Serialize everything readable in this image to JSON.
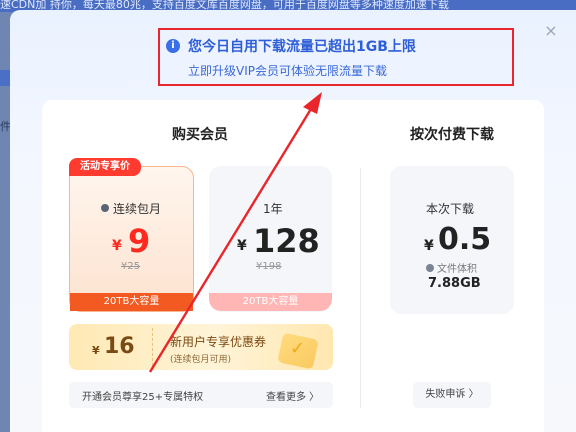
{
  "background": {
    "top_text": "速CDN加 持你，每天最80兆，支持百度文库百度网盘，可用于百度网盘等多种速度加速下载",
    "left_char": "件"
  },
  "dialog": {
    "close_glyph": "×",
    "notice": {
      "icon": "i",
      "title": "您今日自用下载流量已超出1GB上限",
      "subtitle": "立即升级VIP会员可体验无限流量下载"
    },
    "vip_section_title": "购买会员",
    "pay_section_title": "按次付费下载",
    "plans": [
      {
        "badge": "活动专享价",
        "name": "连续包月",
        "currency": "¥",
        "price": "9",
        "original_price": "¥25",
        "capacity": "20TB大容量"
      },
      {
        "name": "1年",
        "currency": "¥",
        "price": "128",
        "original_price": "¥198",
        "capacity": "20TB大容量"
      }
    ],
    "coupon": {
      "currency": "¥",
      "amount": "16",
      "title": "新用户专享优惠券",
      "note": "(连续包月可用)"
    },
    "benefits": {
      "text": "开通会员尊享25+专属特权",
      "more": "查看更多 〉"
    },
    "pay_per_download": {
      "label": "本次下载",
      "currency": "¥",
      "price": "0.5",
      "size_label": "文件体积",
      "size_value": "7.88GB",
      "fail_button": "失败申诉 〉"
    }
  },
  "colors": {
    "notice_border": "#e8262b",
    "accent_blue": "#2f5fd8",
    "price_red": "#ff2a1f",
    "capacity_orange": "#f35a21",
    "coupon_brown": "#7a4a14"
  }
}
